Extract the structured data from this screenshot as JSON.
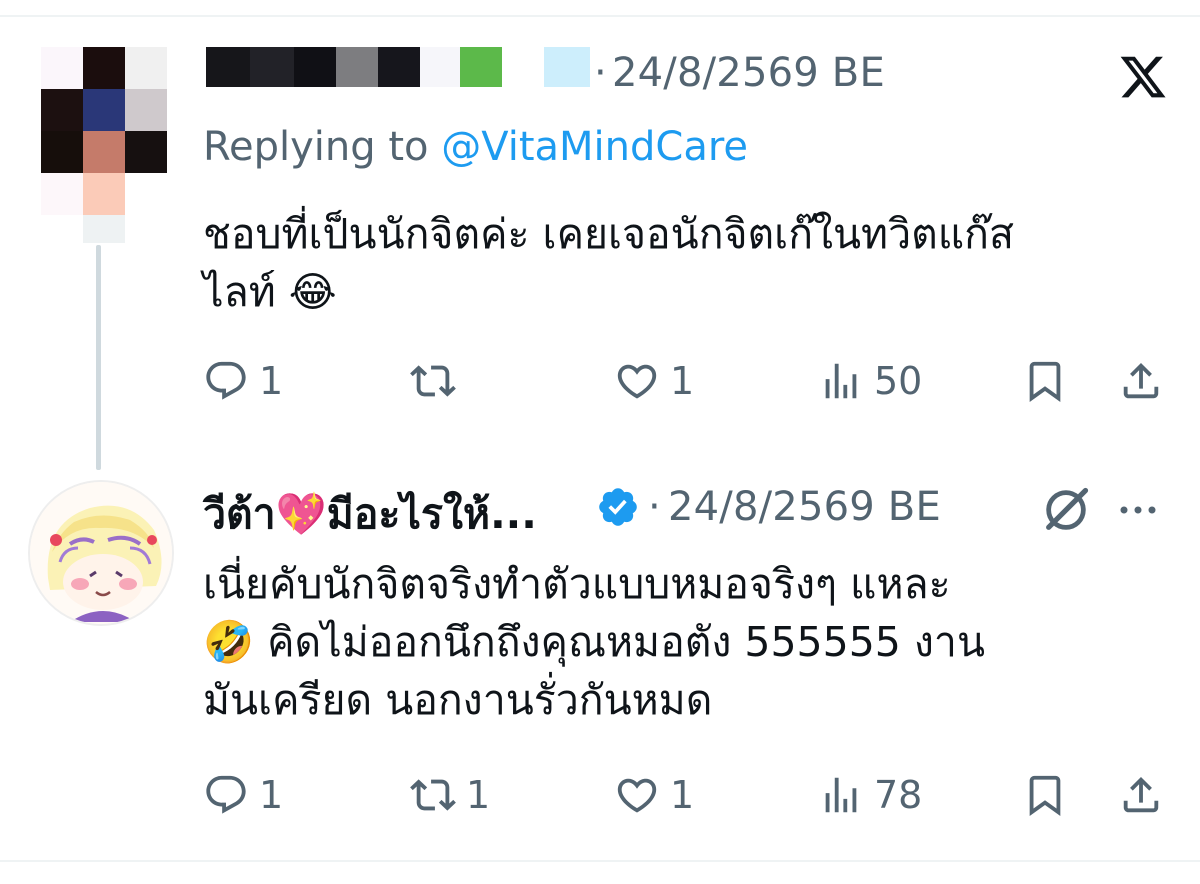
{
  "tweet1": {
    "timestamp": "24/8/2569 BE",
    "separator": "·",
    "replying_prefix": "Replying to ",
    "replying_handle": "@VitaMindCare",
    "text_line1": "ชอบที่เป็นนักจิตค่ะ เคยเจอนักจิตเก๊ในทวิตแก๊ส",
    "text_line2": "ไลท์ 😂",
    "actions": {
      "reply_count": "1",
      "retweet_count": "",
      "like_count": "1",
      "views_count": "50"
    }
  },
  "tweet2": {
    "author_name": "วีต้า💖มีอะไรให้...",
    "separator": "·",
    "timestamp": "24/8/2569 BE",
    "text_line1": "เนี่ยคับนักจิตจริงทำตัวแบบหมอจริงๆ แหละ",
    "text_line2": "🤣 คิดไม่ออกนึกถึงคุณหมอตัง 555555 งาน",
    "text_line3": "มันเครียด นอกงานรั่วกันหมด",
    "actions": {
      "reply_count": "1",
      "retweet_count": "1",
      "like_count": "1",
      "views_count": "78"
    }
  },
  "colors": {
    "text_primary": "#0f1419",
    "text_secondary": "#536471",
    "link": "#1d9bf0",
    "verified": "#1d9bf0",
    "thread_line": "#cfd9de"
  },
  "icons": {
    "reply": "reply-icon",
    "retweet": "retweet-icon",
    "like": "heart-icon",
    "views": "views-icon",
    "bookmark": "bookmark-icon",
    "share": "share-icon",
    "x_logo": "x-logo-icon",
    "verified": "verified-badge-icon",
    "grok": "grok-icon",
    "more": "more-icon"
  }
}
